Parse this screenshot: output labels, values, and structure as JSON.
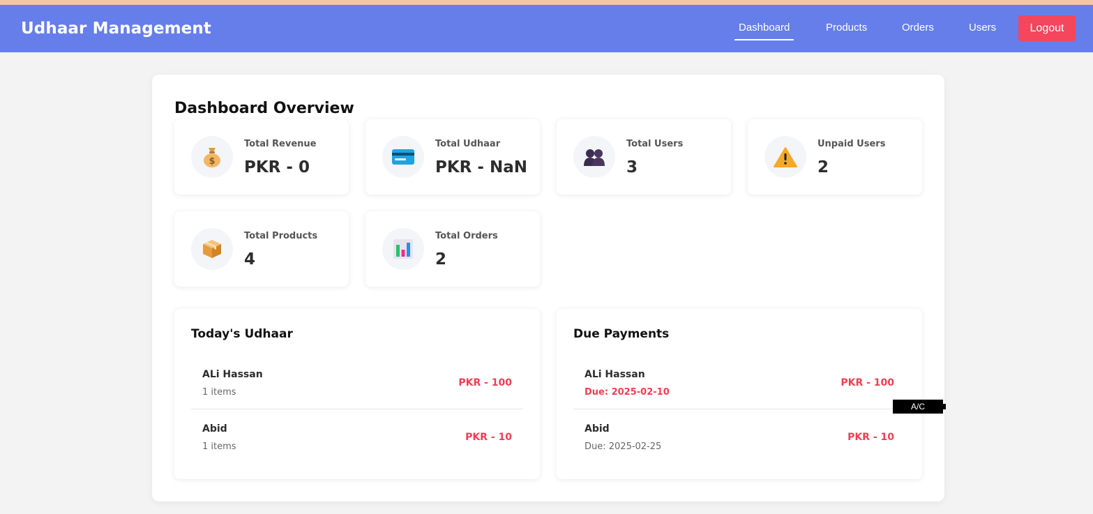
{
  "nav": {
    "brand": "Udhaar Management",
    "links": [
      {
        "label": "Dashboard",
        "active": true
      },
      {
        "label": "Products",
        "active": false
      },
      {
        "label": "Orders",
        "active": false
      },
      {
        "label": "Users",
        "active": false
      }
    ],
    "logout_label": "Logout"
  },
  "page": {
    "title": "Dashboard Overview"
  },
  "stats": [
    {
      "icon": "money-bag-icon",
      "label": "Total Revenue",
      "value": "PKR - 0"
    },
    {
      "icon": "credit-card-icon",
      "label": "Total Udhaar",
      "value": "PKR - NaN"
    },
    {
      "icon": "users-icon",
      "label": "Total Users",
      "value": "3"
    },
    {
      "icon": "warning-icon",
      "label": "Unpaid Users",
      "value": "2"
    },
    {
      "icon": "package-icon",
      "label": "Total Products",
      "value": "4"
    },
    {
      "icon": "bar-chart-icon",
      "label": "Total Orders",
      "value": "2"
    }
  ],
  "today_udhaar": {
    "title": "Today's Udhaar",
    "entries": [
      {
        "name": "ALi Hassan",
        "sub": "1 items",
        "amount": "PKR - 100"
      },
      {
        "name": "Abid",
        "sub": "1 items",
        "amount": "PKR - 10"
      }
    ]
  },
  "due_payments": {
    "title": "Due Payments",
    "entries": [
      {
        "name": "ALi Hassan",
        "sub": "Due: 2025-02-10",
        "amount": "PKR - 100",
        "overdue": true
      },
      {
        "name": "Abid",
        "sub": "Due: 2025-02-25",
        "amount": "PKR - 10",
        "overdue": false
      }
    ]
  },
  "tooltip": {
    "text": "A/C"
  },
  "colors": {
    "nav_bg": "#667eea",
    "logout_bg": "#f4465c",
    "accent_red": "#f03e54",
    "page_bg": "#f3f3f3"
  }
}
